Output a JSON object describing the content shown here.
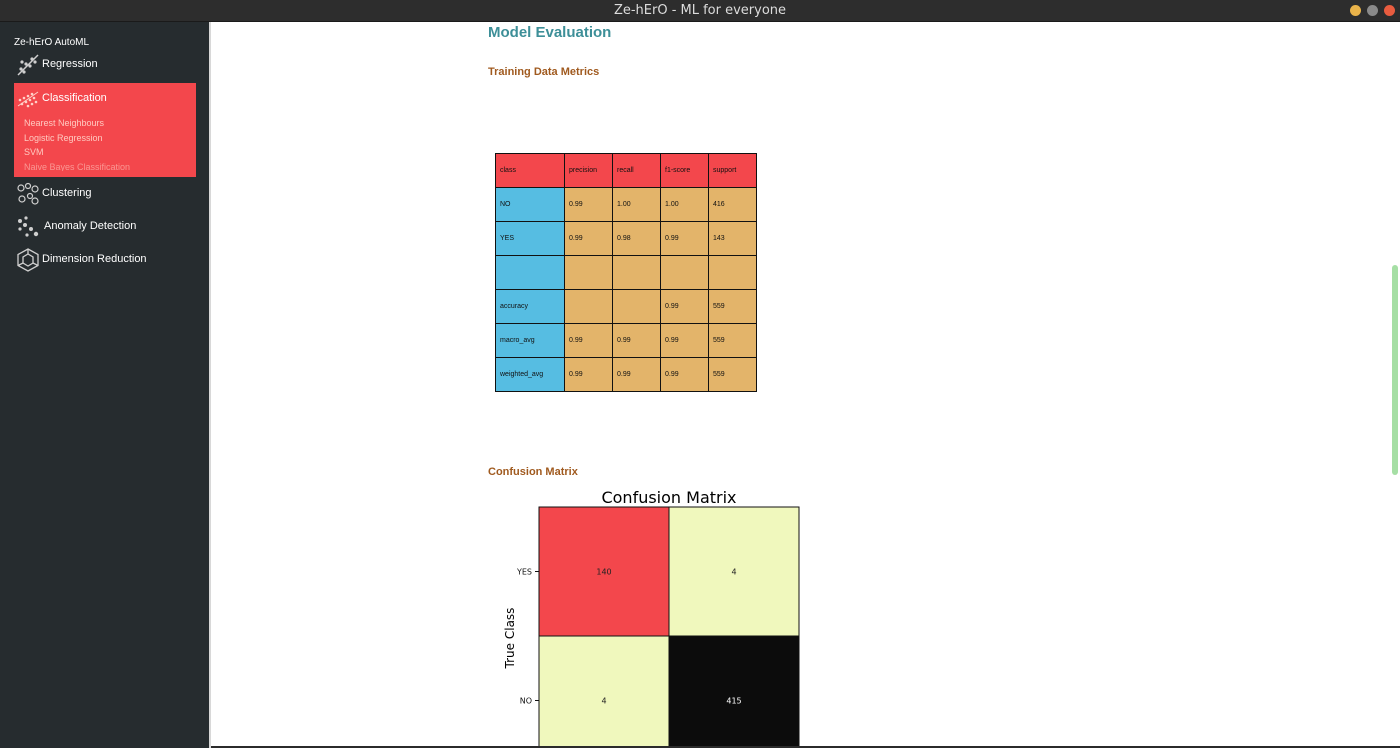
{
  "window": {
    "title": "Ze-hErO - ML for everyone",
    "controls": {
      "minimize_color": "#e9b34a",
      "maximize_color": "#8a8a8a",
      "close_color": "#e85c3f"
    }
  },
  "sidebar": {
    "app_title": "Ze-hErO AutoML",
    "accent": "#f3474c",
    "items": [
      {
        "label": "Regression",
        "icon": "regression-scatter-icon"
      },
      {
        "label": "Classification",
        "icon": "classification-grid-icon",
        "active": true,
        "subitems": [
          "Nearest Neighbours",
          "Logistic Regression",
          "SVM",
          "Naive Bayes Classification"
        ]
      },
      {
        "label": "Clustering",
        "icon": "clustering-nodes-icon"
      },
      {
        "label": "Anomaly Detection",
        "icon": "anomaly-dots-icon"
      },
      {
        "label": "Dimension Reduction",
        "icon": "dimension-cube-icon"
      }
    ]
  },
  "main": {
    "title": "Model Evaluation",
    "training_heading": "Training Data Metrics",
    "metrics_table": {
      "colors": {
        "header": "#f3474c",
        "first_col": "#56bde2",
        "cells": "#e3b46a"
      },
      "columns": [
        "class",
        "precision",
        "recall",
        "f1-score",
        "support"
      ],
      "rows": [
        [
          "NO",
          "0.99",
          "1.00",
          "1.00",
          "416"
        ],
        [
          "YES",
          "0.99",
          "0.98",
          "0.99",
          "143"
        ],
        [
          "",
          "",
          "",
          "",
          ""
        ],
        [
          "accuracy",
          "",
          "",
          "0.99",
          "559"
        ],
        [
          "macro_avg",
          "0.99",
          "0.99",
          "0.99",
          "559"
        ],
        [
          "weighted_avg",
          "0.99",
          "0.99",
          "0.99",
          "559"
        ]
      ]
    },
    "confusion_heading": "Confusion Matrix"
  },
  "chart_data": {
    "type": "heatmap",
    "title": "Confusion Matrix",
    "ylabel": "True Class",
    "y_categories": [
      "YES",
      "NO"
    ],
    "cells": [
      [
        140,
        4
      ],
      [
        4,
        415
      ]
    ],
    "colors": {
      "diag_top": "#f3474c",
      "off": "#f0f8bd",
      "diag_bottom": "#0c0c0c"
    }
  }
}
